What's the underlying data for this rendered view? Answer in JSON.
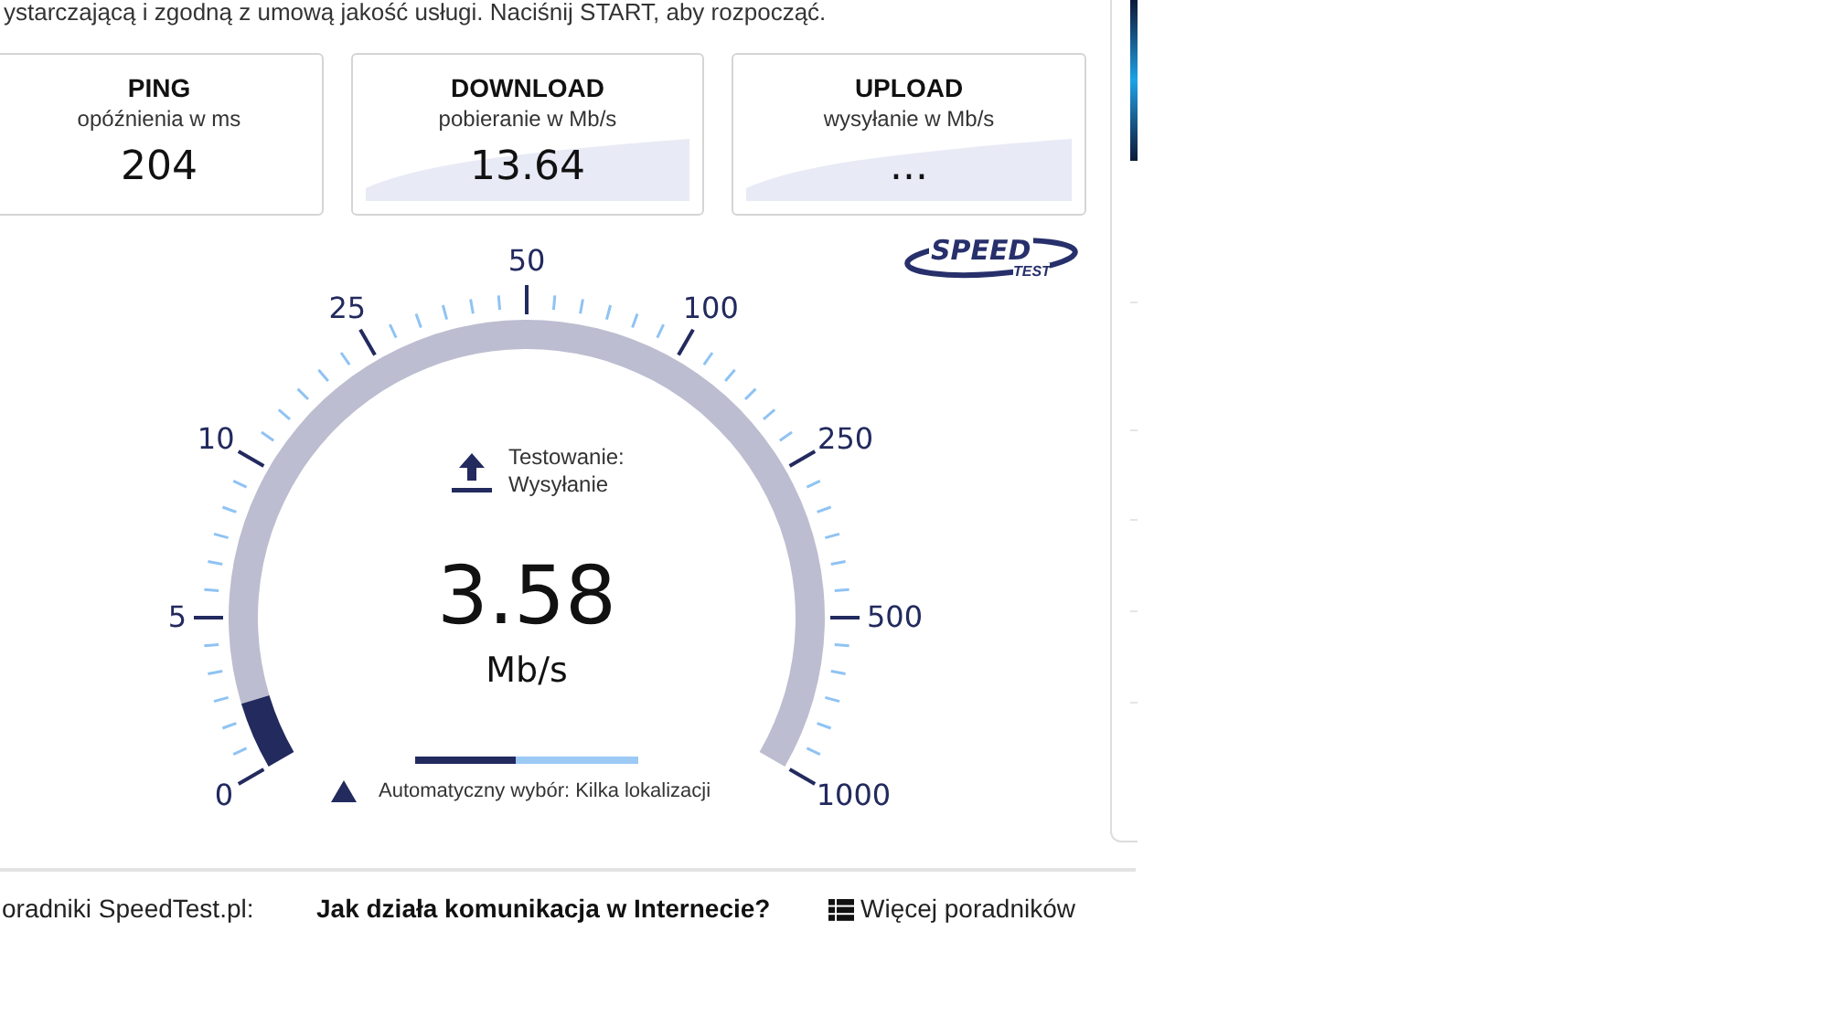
{
  "intro_text": "ystarczającą i zgodną z umową jakość usługi. Naciśnij START, aby rozpocząć.",
  "metrics": [
    {
      "kind": "plain",
      "title": "PING",
      "subtitle": "opóźnienia w ms",
      "value": "204"
    },
    {
      "kind": "sparkline",
      "title": "DOWNLOAD",
      "subtitle": "pobieranie w Mb/s",
      "value": "13.64"
    },
    {
      "kind": "sparkline",
      "title": "UPLOAD",
      "subtitle": "wysyłanie w Mb/s",
      "value": "..."
    }
  ],
  "logo": {
    "word_1": "SPEED",
    "word_2": "TEST"
  },
  "gauge": {
    "scale_labels": [
      "0",
      "5",
      "10",
      "25",
      "50",
      "100",
      "250",
      "500",
      "1000"
    ],
    "level": 0.055,
    "status_label": "Testowanie:",
    "status_value": "Wysyłanie",
    "reading": "3.58",
    "unit": "Mb/s",
    "progress": {
      "level": 0.45
    },
    "server": "Automatyczny wybór: Kilka lokalizacji"
  },
  "footer": {
    "label": "oradniki SpeedTest.pl:",
    "link": "Jak działa komunikacja w Internecie?",
    "more": "Więcej poradników"
  }
}
